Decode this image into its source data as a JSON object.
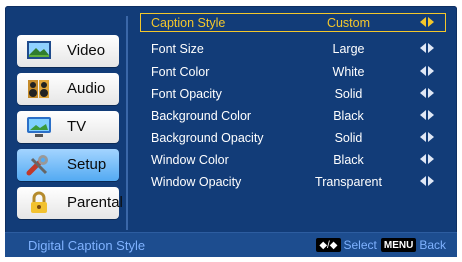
{
  "sidebar": {
    "items": [
      {
        "label": "Video",
        "icon": "video-icon"
      },
      {
        "label": "Audio",
        "icon": "audio-icon"
      },
      {
        "label": "TV",
        "icon": "tv-icon"
      },
      {
        "label": "Setup",
        "icon": "setup-icon"
      },
      {
        "label": "Parental",
        "icon": "lock-icon"
      }
    ],
    "active_index": 3
  },
  "settings": {
    "rows": [
      {
        "name": "Caption Style",
        "value": "Custom"
      },
      {
        "name": "Font Size",
        "value": "Large"
      },
      {
        "name": "Font Color",
        "value": "White"
      },
      {
        "name": "Font Opacity",
        "value": "Solid"
      },
      {
        "name": "Background Color",
        "value": "Black"
      },
      {
        "name": "Background Opacity",
        "value": "Solid"
      },
      {
        "name": "Window Color",
        "value": "Black"
      },
      {
        "name": "Window Opacity",
        "value": "Transparent"
      }
    ],
    "active_index": 0
  },
  "footer": {
    "title": "Digital Caption Style",
    "select_key": "◆/◆",
    "select_label": "Select",
    "back_key": "MENU",
    "back_label": "Back"
  },
  "colors": {
    "panel": "#123c78",
    "highlight": "#f3c72c",
    "footer_text": "#7fb2ff",
    "active_sidebar": "#53aaf2"
  }
}
